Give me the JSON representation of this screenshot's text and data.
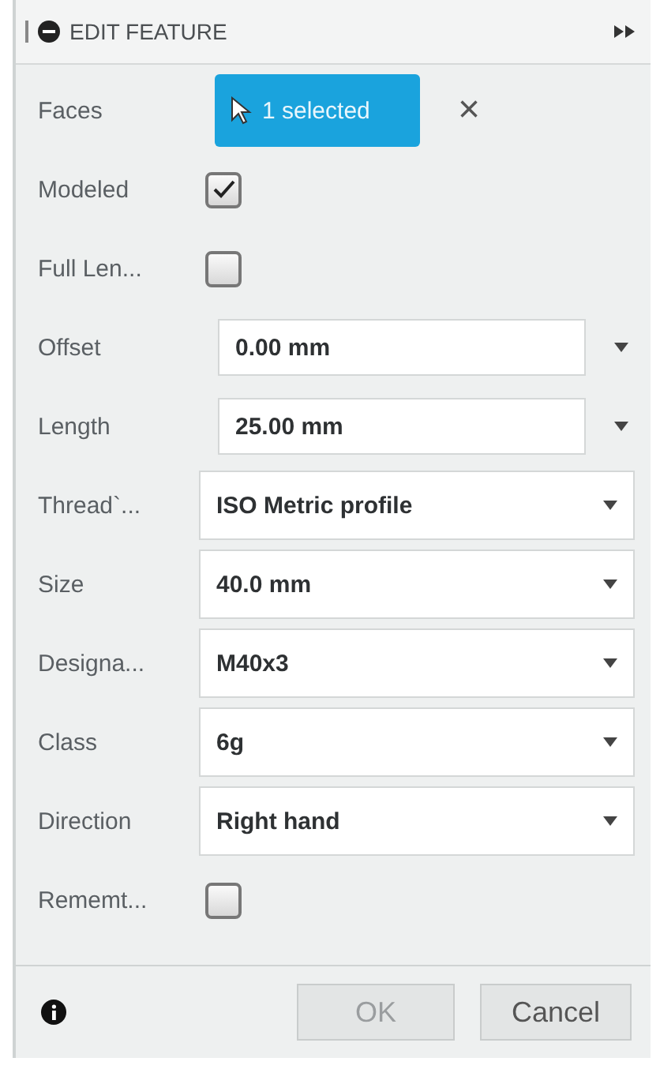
{
  "header": {
    "title": "EDIT FEATURE"
  },
  "rows": [
    {
      "kind": "selection",
      "label": "Faces",
      "value": "1 selected",
      "clear": "×"
    },
    {
      "kind": "checkbox",
      "label": "Modeled",
      "checked": true
    },
    {
      "kind": "checkbox",
      "label": "Full Len...",
      "checked": false
    },
    {
      "kind": "spin",
      "label": "Offset",
      "value": "0.00 mm"
    },
    {
      "kind": "spin",
      "label": "Length",
      "value": "25.00 mm"
    },
    {
      "kind": "dropdown",
      "label": "Thread`...",
      "value": "ISO Metric profile"
    },
    {
      "kind": "dropdown",
      "label": "Size",
      "value": "40.0 mm"
    },
    {
      "kind": "dropdown",
      "label": "Designa...",
      "value": "M40x3"
    },
    {
      "kind": "dropdown",
      "label": "Class",
      "value": "6g"
    },
    {
      "kind": "dropdown",
      "label": "Direction",
      "value": "Right hand"
    },
    {
      "kind": "checkbox",
      "label": "Rememt...",
      "checked": false
    }
  ],
  "footer": {
    "ok": {
      "label": "OK",
      "disabled": true
    },
    "cancel": {
      "label": "Cancel",
      "disabled": false
    }
  }
}
